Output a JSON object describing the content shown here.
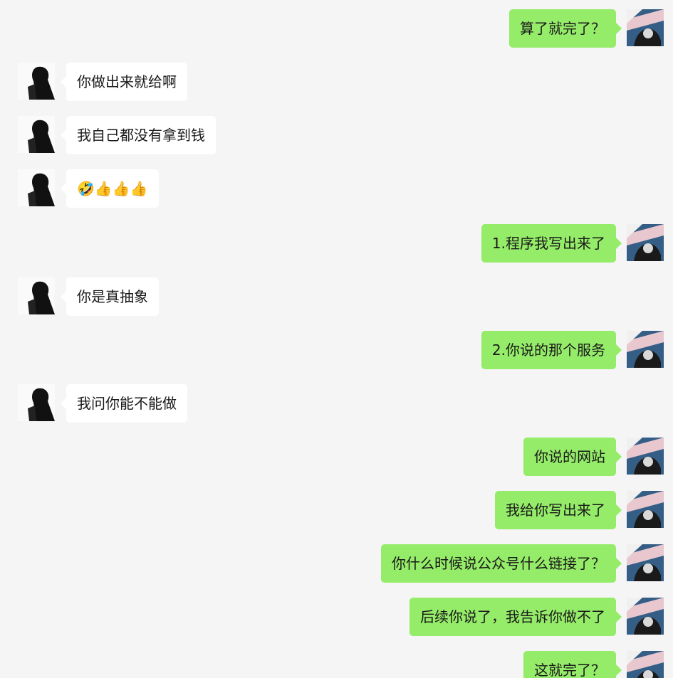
{
  "messages": [
    {
      "side": "right",
      "text": "算了就完了？"
    },
    {
      "side": "left",
      "text": "你做出来就给啊"
    },
    {
      "side": "left",
      "text": "我自己都没有拿到钱"
    },
    {
      "side": "left",
      "text": "🤣👍👍👍"
    },
    {
      "side": "right",
      "text": "1.程序我写出来了"
    },
    {
      "side": "left",
      "text": "你是真抽象"
    },
    {
      "side": "right",
      "text": "2.你说的那个服务"
    },
    {
      "side": "left",
      "text": "我问你能不能做"
    },
    {
      "side": "right",
      "text": "你说的网站"
    },
    {
      "side": "right",
      "text": "我给你写出来了"
    },
    {
      "side": "right",
      "text": "你什么时候说公众号什么链接了？"
    },
    {
      "side": "right",
      "text": "后续你说了，我告诉你做不了"
    },
    {
      "side": "right",
      "text": "这就完了？"
    }
  ]
}
